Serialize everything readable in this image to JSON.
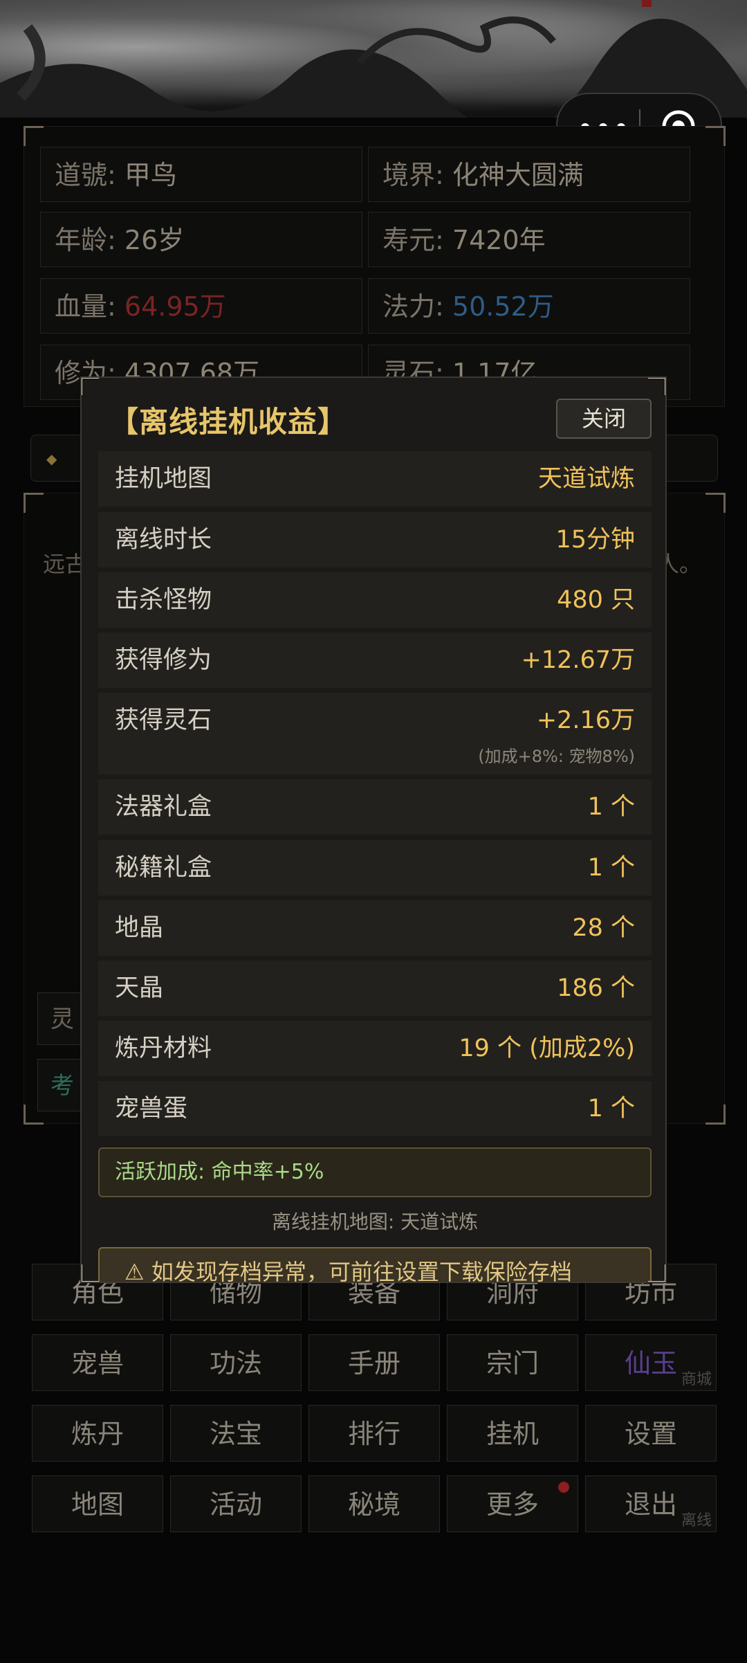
{
  "header": {
    "menu_icon": "more-dots-icon",
    "target_icon": "target-icon"
  },
  "profile": {
    "name_label": "道號:",
    "name_value": "甲鸟",
    "realm_label": "境界:",
    "realm_value": "化神大圆满",
    "age_label": "年龄:",
    "age_value": "26岁",
    "lifespan_label": "寿元:",
    "lifespan_value": "7420年",
    "hp_label": "血量:",
    "hp_value": "64.95万",
    "mp_label": "法力:",
    "mp_value": "50.52万",
    "cultivation_label": "修为:",
    "cultivation_value": "4307.68万",
    "spirit_stone_label": "灵石:",
    "spirit_stone_value": "1.17亿"
  },
  "background": {
    "story_prefix": "远古",
    "story_suffix": "人。",
    "side_btn_1": "灵",
    "side_btn_2": "考"
  },
  "modal": {
    "title": "【离线挂机收益】",
    "close_label": "关闭",
    "rows": [
      {
        "label": "挂机地图",
        "value": "天道试炼"
      },
      {
        "label": "离线时长",
        "value": "15分钟"
      },
      {
        "label": "击杀怪物",
        "value": "480 只"
      },
      {
        "label": "获得修为",
        "value": "+12.67万"
      },
      {
        "label": "获得灵石",
        "value": "+2.16万",
        "note": "(加成+8%: 宠物8%)"
      },
      {
        "label": "法器礼盒",
        "value": "1 个"
      },
      {
        "label": "秘籍礼盒",
        "value": "1 个"
      },
      {
        "label": "地晶",
        "value": "28 个"
      },
      {
        "label": "天晶",
        "value": "186 个"
      },
      {
        "label": "炼丹材料",
        "value": "19 个 (加成2%)"
      },
      {
        "label": "宠兽蛋",
        "value": "1 个"
      }
    ],
    "active_bonus": "活跃加成: 命中率+5%",
    "map_note": "离线挂机地图: 天道试炼",
    "warning": "⚠ 如发现存档异常，可前往设置下载保险存档"
  },
  "nav": {
    "row1": [
      "角色",
      "储物",
      "装备",
      "洞府",
      "坊市"
    ],
    "row2": [
      "宠兽",
      "功法",
      "手册",
      "宗门",
      "仙玉"
    ],
    "row2_sub": "商城",
    "row3": [
      "炼丹",
      "法宝",
      "排行",
      "挂机",
      "设置"
    ],
    "row4": [
      "地图",
      "活动",
      "秘境",
      "更多",
      "退出"
    ],
    "row4_sub": "离线"
  },
  "colors": {
    "gold": "#f0c25a",
    "hp_red": "#7a2424",
    "mp_blue": "#2f5c86",
    "bonus_green": "#a9d98a"
  }
}
